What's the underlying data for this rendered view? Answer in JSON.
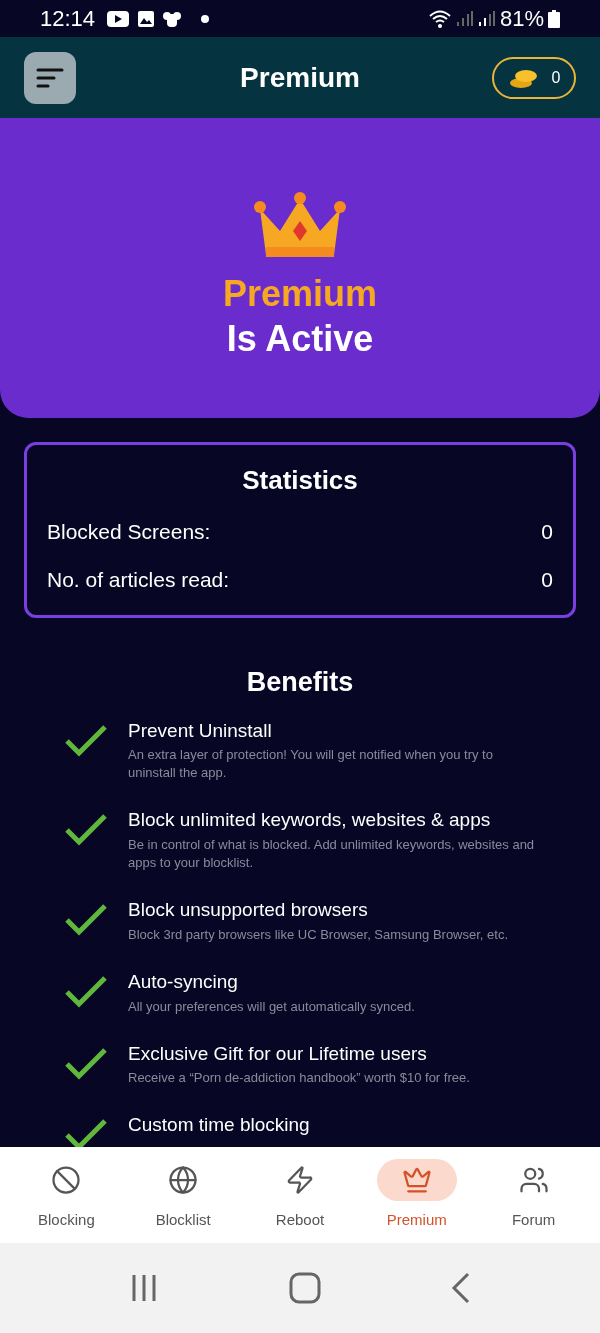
{
  "status_bar": {
    "time": "12:14",
    "battery": "81%"
  },
  "header": {
    "title": "Premium",
    "coins": "0"
  },
  "hero": {
    "title": "Premium",
    "subtitle": "Is Active"
  },
  "statistics": {
    "title": "Statistics",
    "rows": [
      {
        "label": "Blocked Screens:",
        "value": "0"
      },
      {
        "label": "No. of articles read:",
        "value": "0"
      }
    ]
  },
  "benefits": {
    "title": "Benefits",
    "items": [
      {
        "title": "Prevent Uninstall",
        "description": "An extra layer of protection! You will get notified when you try to uninstall the app."
      },
      {
        "title": "Block unlimited keywords, websites & apps",
        "description": "Be in control of what is blocked. Add unlimited keywords, websites and apps to your blocklist."
      },
      {
        "title": "Block unsupported browsers",
        "description": "Block 3rd party browsers like UC Browser, Samsung Browser, etc."
      },
      {
        "title": "Auto-syncing",
        "description": "All your preferences will get automatically synced."
      },
      {
        "title": "Exclusive Gift for our Lifetime users",
        "description": "Receive a “Porn de-addiction handbook” worth $10 for free."
      },
      {
        "title": "Custom time blocking"
      }
    ]
  },
  "bottom_nav": [
    {
      "label": "Blocking",
      "kind": "blocking",
      "selected": false
    },
    {
      "label": "Blocklist",
      "kind": "blocklist",
      "selected": false
    },
    {
      "label": "Reboot",
      "kind": "reboot",
      "selected": false
    },
    {
      "label": "Premium",
      "kind": "premium",
      "selected": true
    },
    {
      "label": "Forum",
      "kind": "forum",
      "selected": false
    }
  ]
}
